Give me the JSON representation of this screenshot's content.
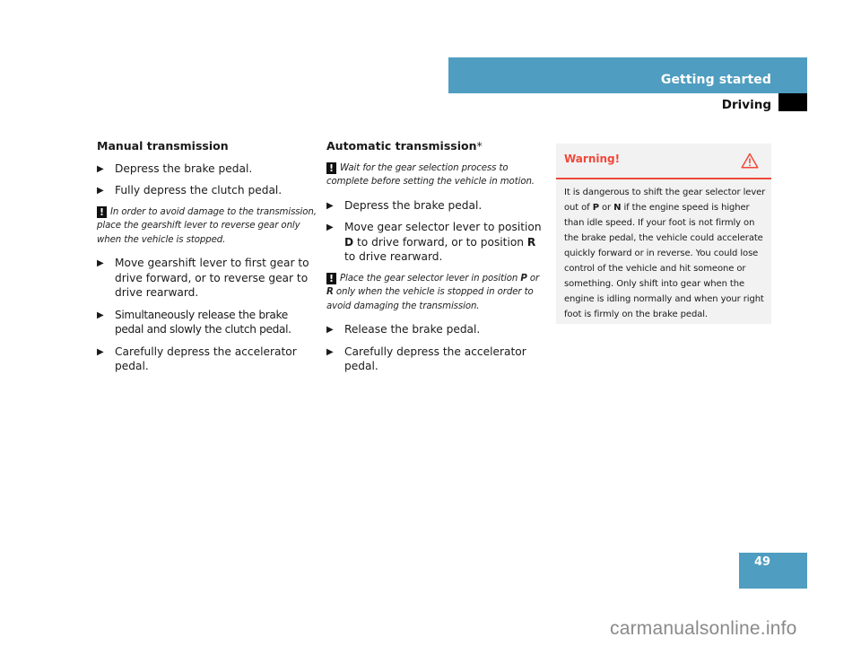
{
  "header": {
    "section": "Getting started",
    "subsection": "Driving"
  },
  "manual": {
    "title": "Manual transmission",
    "steps_before_note": [
      "Depress the brake pedal.",
      "Fully depress the clutch pedal."
    ],
    "note": "In order to avoid damage to the transmission, place the gearshift lever to reverse gear only when the vehicle is stopped.",
    "steps_after_note": [
      "Move gearshift lever to first gear to drive forward, or to reverse gear to drive rearward.",
      "Simultaneously release the brake pedal and slowly the clutch pedal.",
      "Carefully depress the accelerator pedal."
    ]
  },
  "automatic": {
    "title": "Automatic transmission",
    "title_mark": "*",
    "note1": "Wait for the gear selection process to complete before setting the vehicle in motion.",
    "step1": "Depress the brake pedal.",
    "step2": {
      "part1": "Move gear selector lever to position ",
      "gear_d": "D",
      "part2": " to drive forward, or to position ",
      "gear_r": "R",
      "part3": " to drive rearward."
    },
    "note2": {
      "part1": "Place the gear selector lever in position ",
      "gear_p": "P",
      "part2": " or ",
      "gear_r": "R",
      "part3": " only when the vehicle is stopped in order to avoid damaging the transmission."
    },
    "step3": "Release the brake pedal.",
    "step4": "Carefully depress the accelerator pedal."
  },
  "warning": {
    "heading": "Warning!",
    "icon": "warning-triangle-icon",
    "text": {
      "part1": "It is dangerous to shift the gear selector lever out of ",
      "gear_p": "P",
      "part2": " or ",
      "gear_n": "N",
      "part3": " if the engine speed is higher than idle speed. If your foot is not firmly on the brake pedal, the vehicle could accelerate quickly forward or in reverse. You could lose control of the vehicle and hit someone or something. Only shift into gear when the engine is idling normally and when your right foot is firmly on the brake pedal."
    },
    "color": "#f0483a"
  },
  "note_icon": "exclamation-icon",
  "bullet_glyph": "▶",
  "page_number": "49",
  "watermark": "carmanualsonline.info",
  "colors": {
    "accent": "#4f9dc0",
    "warning": "#f0483a",
    "warning_bg": "#f2f2f2"
  }
}
